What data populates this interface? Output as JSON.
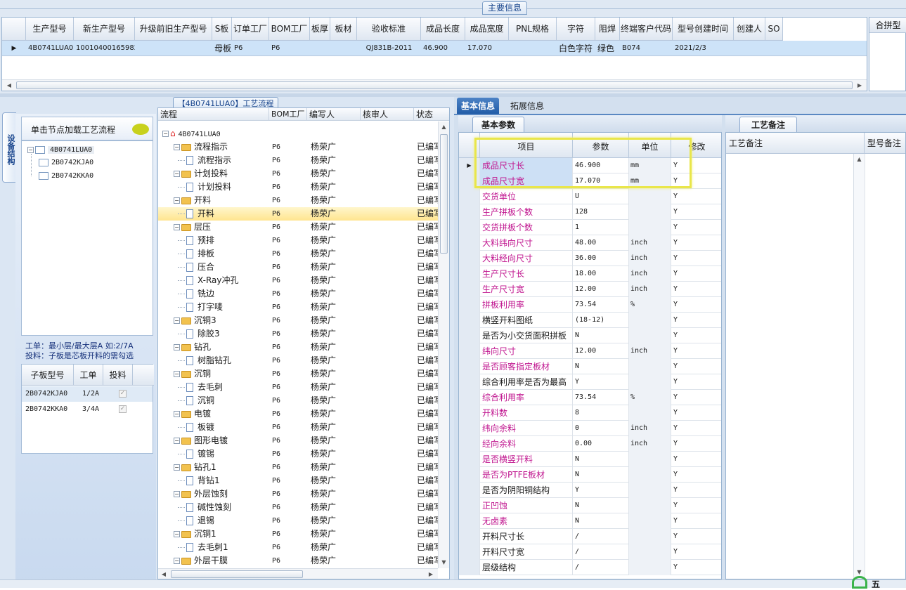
{
  "main_caption": "主要信息",
  "top_grid": {
    "columns": [
      "生产型号",
      "新生产型号",
      "升级前旧生产型号",
      "S板",
      "订单工厂",
      "BOM工厂",
      "板厚",
      "板材",
      "验收标准",
      "成品长度",
      "成品宽度",
      "PNL规格",
      "字符",
      "阻焊",
      "终端客户代码",
      "型号创建时间",
      "创建人",
      "SO"
    ],
    "row": [
      "4B0741LUA0",
      "10010400165982",
      "",
      "母板",
      "P6",
      "P6",
      "",
      "",
      "QJ831B-2011",
      "46.900",
      "17.070",
      "",
      "白色字符",
      "绿色",
      "B074",
      "2021/2/3",
      "",
      ""
    ],
    "merge_header": "合拼型"
  },
  "left": {
    "vertical_tab": "设备结构",
    "hint": "单击节点加载工艺流程",
    "tree": {
      "root": "4B0741LUA0",
      "children": [
        "2B0742KJA0",
        "2B0742KKA0"
      ]
    },
    "note1": "工单：最小层/最大层A 如:2/7A",
    "note2": "投料：子板是芯板开料的需勾选",
    "sub_grid": {
      "columns": [
        "子板型号",
        "工单",
        "投料"
      ],
      "rows": [
        [
          "2B0742KJA0",
          "1/2A",
          "✓"
        ],
        [
          "2B0742KKA0",
          "3/4A",
          "✓"
        ]
      ]
    }
  },
  "process": {
    "caption": "【4B0741LUA0】工艺流程",
    "columns": [
      "流程",
      "BOM工厂",
      "编写人",
      "核审人",
      "状态"
    ],
    "root": "4B0741LUA0",
    "rows": [
      {
        "name": "流程指示",
        "type": "folder",
        "bom": "P6",
        "writer": "杨荣广",
        "status": "已编写"
      },
      {
        "name": "流程指示",
        "type": "doc",
        "bom": "P6",
        "writer": "杨荣广",
        "status": "已编写"
      },
      {
        "name": "计划投料",
        "type": "folder",
        "bom": "P6",
        "writer": "杨荣广",
        "status": "已编写"
      },
      {
        "name": "计划投料",
        "type": "doc",
        "bom": "P6",
        "writer": "杨荣广",
        "status": "已编写"
      },
      {
        "name": "开料",
        "type": "folder",
        "bom": "P6",
        "writer": "杨荣广",
        "status": "已编写"
      },
      {
        "name": "开料",
        "type": "doc",
        "bom": "P6",
        "writer": "杨荣广",
        "status": "已编写",
        "selected": true
      },
      {
        "name": "层压",
        "type": "folder",
        "bom": "P6",
        "writer": "杨荣广",
        "status": "已编写"
      },
      {
        "name": "预排",
        "type": "doc",
        "bom": "P6",
        "writer": "杨荣广",
        "status": "已编写"
      },
      {
        "name": "排板",
        "type": "doc",
        "bom": "P6",
        "writer": "杨荣广",
        "status": "已编写"
      },
      {
        "name": "压合",
        "type": "doc",
        "bom": "P6",
        "writer": "杨荣广",
        "status": "已编写"
      },
      {
        "name": "X-Ray冲孔",
        "type": "doc",
        "bom": "P6",
        "writer": "杨荣广",
        "status": "已编写"
      },
      {
        "name": "铣边",
        "type": "doc",
        "bom": "P6",
        "writer": "杨荣广",
        "status": "已编写"
      },
      {
        "name": "打字唛",
        "type": "doc",
        "bom": "P6",
        "writer": "杨荣广",
        "status": "已编写"
      },
      {
        "name": "沉铜3",
        "type": "folder",
        "bom": "P6",
        "writer": "杨荣广",
        "status": "已编写"
      },
      {
        "name": "除胶3",
        "type": "doc",
        "bom": "P6",
        "writer": "杨荣广",
        "status": "已编写"
      },
      {
        "name": "钻孔",
        "type": "folder",
        "bom": "P6",
        "writer": "杨荣广",
        "status": "已编写"
      },
      {
        "name": "树脂钻孔",
        "type": "doc",
        "bom": "P6",
        "writer": "杨荣广",
        "status": "已编写"
      },
      {
        "name": "沉铜",
        "type": "folder",
        "bom": "P6",
        "writer": "杨荣广",
        "status": "已编写"
      },
      {
        "name": "去毛刺",
        "type": "doc",
        "bom": "P6",
        "writer": "杨荣广",
        "status": "已编写"
      },
      {
        "name": "沉铜",
        "type": "doc",
        "bom": "P6",
        "writer": "杨荣广",
        "status": "已编写"
      },
      {
        "name": "电镀",
        "type": "folder",
        "bom": "P6",
        "writer": "杨荣广",
        "status": "已编写"
      },
      {
        "name": "板镀",
        "type": "doc",
        "bom": "P6",
        "writer": "杨荣广",
        "status": "已编写"
      },
      {
        "name": "图形电镀",
        "type": "folder",
        "bom": "P6",
        "writer": "杨荣广",
        "status": "已编写"
      },
      {
        "name": "镀锡",
        "type": "doc",
        "bom": "P6",
        "writer": "杨荣广",
        "status": "已编写"
      },
      {
        "name": "钻孔1",
        "type": "folder",
        "bom": "P6",
        "writer": "杨荣广",
        "status": "已编写"
      },
      {
        "name": "背钻1",
        "type": "doc",
        "bom": "P6",
        "writer": "杨荣广",
        "status": "已编写"
      },
      {
        "name": "外层蚀刻",
        "type": "folder",
        "bom": "P6",
        "writer": "杨荣广",
        "status": "已编写"
      },
      {
        "name": "碱性蚀刻",
        "type": "doc",
        "bom": "P6",
        "writer": "杨荣广",
        "status": "已编写"
      },
      {
        "name": "退锡",
        "type": "doc",
        "bom": "P6",
        "writer": "杨荣广",
        "status": "已编写"
      },
      {
        "name": "沉铜1",
        "type": "folder",
        "bom": "P6",
        "writer": "杨荣广",
        "status": "已编写"
      },
      {
        "name": "去毛刺1",
        "type": "doc",
        "bom": "P6",
        "writer": "杨荣广",
        "status": "已编写"
      },
      {
        "name": "外层干膜",
        "type": "folder",
        "bom": "P6",
        "writer": "杨荣广",
        "status": "已编写"
      }
    ]
  },
  "right": {
    "tabs": [
      "基本信息",
      "拓展信息"
    ],
    "sub_tab": "基本参数",
    "note_tab": "工艺备注",
    "params_columns": [
      "项目",
      "参数",
      "单位",
      "修改"
    ],
    "params": [
      {
        "item": "成品尺寸长",
        "value": "46.900",
        "unit": "mm",
        "edit": "Y",
        "pink": true
      },
      {
        "item": "成品尺寸宽",
        "value": "17.070",
        "unit": "mm",
        "edit": "Y",
        "pink": true
      },
      {
        "item": "交货单位",
        "value": "U",
        "unit": "",
        "edit": "Y",
        "pink": true
      },
      {
        "item": "生产拼板个数",
        "value": "128",
        "unit": "",
        "edit": "Y",
        "pink": true
      },
      {
        "item": "交货拼板个数",
        "value": "1",
        "unit": "",
        "edit": "Y",
        "pink": true
      },
      {
        "item": "大料纬向尺寸",
        "value": "48.00",
        "unit": "inch",
        "edit": "Y",
        "pink": true
      },
      {
        "item": "大料经向尺寸",
        "value": "36.00",
        "unit": "inch",
        "edit": "Y",
        "pink": true
      },
      {
        "item": "生产尺寸长",
        "value": "18.00",
        "unit": "inch",
        "edit": "Y",
        "pink": true
      },
      {
        "item": "生产尺寸宽",
        "value": "12.00",
        "unit": "inch",
        "edit": "Y",
        "pink": true
      },
      {
        "item": "拼板利用率",
        "value": "73.54",
        "unit": "%",
        "edit": "Y",
        "pink": true
      },
      {
        "item": "横竖开料图纸",
        "value": "(18-12)",
        "unit": "",
        "edit": "Y",
        "pink": false
      },
      {
        "item": "是否为小交货面积拼板",
        "value": "N",
        "unit": "",
        "edit": "Y",
        "pink": false
      },
      {
        "item": "纬向尺寸",
        "value": "12.00",
        "unit": "inch",
        "edit": "Y",
        "pink": true
      },
      {
        "item": "是否顾客指定板材",
        "value": "N",
        "unit": "",
        "edit": "Y",
        "pink": true
      },
      {
        "item": "综合利用率是否为最高",
        "value": "Y",
        "unit": "",
        "edit": "Y",
        "pink": false
      },
      {
        "item": "综合利用率",
        "value": "73.54",
        "unit": "%",
        "edit": "Y",
        "pink": true
      },
      {
        "item": "开料数",
        "value": "8",
        "unit": "",
        "edit": "Y",
        "pink": true
      },
      {
        "item": "纬向余料",
        "value": "0",
        "unit": "inch",
        "edit": "Y",
        "pink": true
      },
      {
        "item": "经向余料",
        "value": "0.00",
        "unit": "inch",
        "edit": "Y",
        "pink": true
      },
      {
        "item": "是否横竖开料",
        "value": "N",
        "unit": "",
        "edit": "Y",
        "pink": true
      },
      {
        "item": "是否为PTFE板材",
        "value": "N",
        "unit": "",
        "edit": "Y",
        "pink": true
      },
      {
        "item": "是否为阴阳铜结构",
        "value": "Y",
        "unit": "",
        "edit": "Y",
        "pink": false
      },
      {
        "item": "正凹蚀",
        "value": "N",
        "unit": "",
        "edit": "Y",
        "pink": true
      },
      {
        "item": "无卤素",
        "value": "N",
        "unit": "",
        "edit": "Y",
        "pink": true
      },
      {
        "item": "开料尺寸长",
        "value": "/",
        "unit": "",
        "edit": "Y",
        "pink": false
      },
      {
        "item": "开料尺寸宽",
        "value": "/",
        "unit": "",
        "edit": "Y",
        "pink": false
      },
      {
        "item": "层级结构",
        "value": "/",
        "unit": "",
        "edit": "Y",
        "pink": false
      }
    ],
    "notes_columns": [
      "工艺备注",
      "型号备注"
    ]
  },
  "status_tray": "五"
}
